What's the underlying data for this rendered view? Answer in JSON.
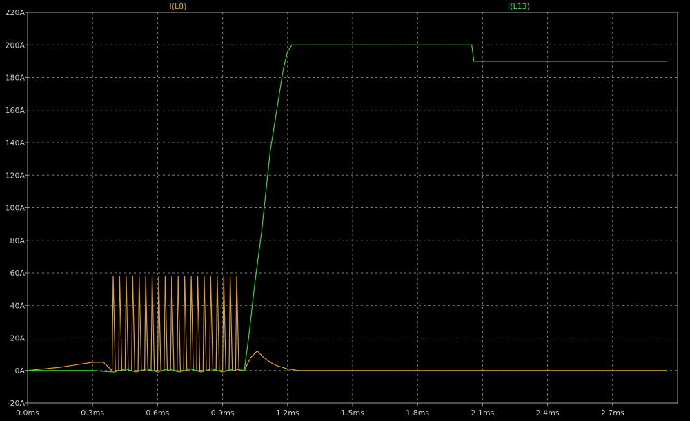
{
  "chart_data": {
    "type": "line",
    "xlabel": "",
    "ylabel": "",
    "xlim": [
      0,
      3.0
    ],
    "ylim": [
      -20,
      220
    ],
    "grid": true,
    "x_ticks": [
      "0.0ms",
      "0.3ms",
      "0.6ms",
      "0.9ms",
      "1.2ms",
      "1.5ms",
      "1.8ms",
      "2.1ms",
      "2.4ms",
      "2.7ms"
    ],
    "x_tick_values": [
      0.0,
      0.3,
      0.6,
      0.9,
      1.2,
      1.5,
      1.8,
      2.1,
      2.4,
      2.7
    ],
    "y_ticks": [
      "-20A",
      "0A",
      "20A",
      "40A",
      "60A",
      "80A",
      "100A",
      "120A",
      "140A",
      "160A",
      "180A",
      "200A",
      "220A"
    ],
    "y_tick_values": [
      -20,
      0,
      20,
      40,
      60,
      80,
      100,
      120,
      140,
      160,
      180,
      200,
      220
    ],
    "colors": {
      "background": "#000000",
      "axis": "#a0a0a0",
      "grid": "#808080",
      "i_l8": "#e0a030",
      "i_l13": "#30e030"
    },
    "series": [
      {
        "name": "I(L8)",
        "color": "#e0a030",
        "x": [
          0.0,
          0.15,
          0.2,
          0.25,
          0.3,
          0.35,
          0.39,
          0.395,
          0.405,
          0.42,
          0.425,
          0.435,
          0.45,
          0.455,
          0.465,
          0.48,
          0.485,
          0.495,
          0.51,
          0.515,
          0.525,
          0.54,
          0.545,
          0.555,
          0.57,
          0.575,
          0.585,
          0.6,
          0.605,
          0.615,
          0.63,
          0.635,
          0.645,
          0.66,
          0.665,
          0.675,
          0.69,
          0.695,
          0.705,
          0.72,
          0.725,
          0.735,
          0.75,
          0.755,
          0.765,
          0.78,
          0.785,
          0.795,
          0.81,
          0.815,
          0.825,
          0.84,
          0.845,
          0.855,
          0.87,
          0.875,
          0.885,
          0.9,
          0.905,
          0.915,
          0.93,
          0.935,
          0.945,
          0.96,
          0.965,
          0.975,
          1.0,
          1.03,
          1.06,
          1.09,
          1.12,
          1.15,
          1.2,
          1.25,
          1.5,
          2.0,
          2.5,
          2.95
        ],
        "y": [
          0,
          2,
          3,
          4,
          5,
          5,
          0,
          58,
          0,
          0,
          58,
          0,
          0,
          58,
          0,
          0,
          58,
          0,
          0,
          58,
          0,
          0,
          58,
          0,
          0,
          58,
          0,
          0,
          58,
          0,
          0,
          58,
          0,
          0,
          58,
          0,
          0,
          58,
          0,
          0,
          58,
          0,
          0,
          58,
          0,
          0,
          58,
          0,
          0,
          58,
          0,
          0,
          58,
          0,
          0,
          58,
          0,
          0,
          58,
          0,
          0,
          58,
          0,
          0,
          58,
          0,
          0,
          8,
          12,
          8,
          5,
          3,
          1,
          0,
          0,
          0,
          0,
          0
        ]
      },
      {
        "name": "I(L13)",
        "color": "#30e030",
        "x": [
          0.0,
          0.3,
          0.4,
          0.45,
          0.5,
          0.55,
          0.6,
          0.65,
          0.7,
          0.75,
          0.8,
          0.85,
          0.9,
          0.95,
          1.0,
          1.02,
          1.05,
          1.08,
          1.1,
          1.12,
          1.15,
          1.18,
          1.2,
          1.22,
          1.25,
          1.3,
          1.4,
          1.5,
          1.6,
          1.7,
          1.8,
          1.9,
          2.0,
          2.05,
          2.06,
          2.1,
          2.2,
          2.3,
          2.4,
          2.5,
          2.6,
          2.7,
          2.8,
          2.9,
          2.95
        ],
        "y": [
          0,
          0,
          -1,
          1,
          -1,
          1,
          -1,
          1,
          -1,
          1,
          -1,
          1,
          -1,
          1,
          0,
          20,
          55,
          85,
          110,
          135,
          160,
          185,
          196,
          200,
          200,
          200,
          200,
          200,
          200,
          200,
          200,
          200,
          200,
          200,
          190,
          190,
          190,
          190,
          190,
          190,
          190,
          190,
          190,
          190,
          190
        ]
      }
    ]
  }
}
